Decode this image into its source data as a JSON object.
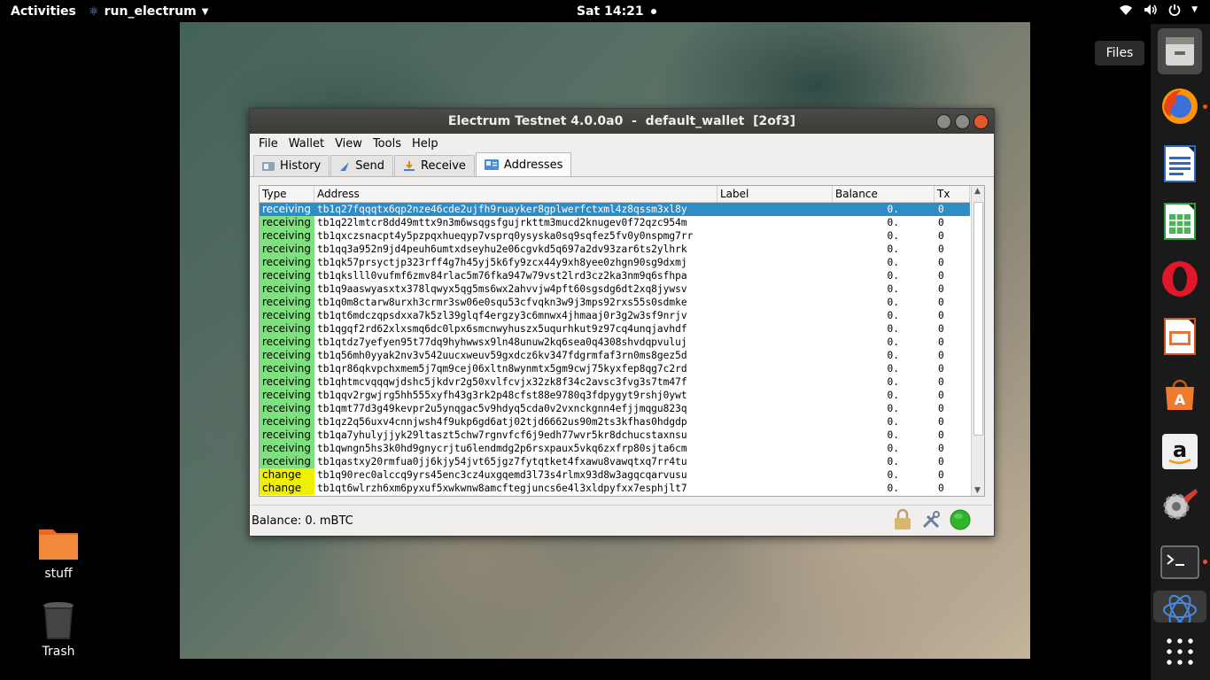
{
  "topbar": {
    "activities": "Activities",
    "app_name": "run_electrum",
    "clock": "Sat 14:21"
  },
  "dock": {
    "tooltip": "Files",
    "items": [
      "files-icon",
      "firefox-icon",
      "writer-icon",
      "calc-icon",
      "opera-icon",
      "impress-icon",
      "software-icon",
      "amazon-icon",
      "settings-icon",
      "terminal-icon",
      "electrum-icon",
      "show-apps-icon"
    ]
  },
  "desktop": {
    "stuff_label": "stuff",
    "trash_label": "Trash"
  },
  "window": {
    "title": "Electrum Testnet 4.0.0a0  -  default_wallet  [2of3]",
    "menus": [
      "File",
      "Wallet",
      "View",
      "Tools",
      "Help"
    ],
    "tabs": [
      "History",
      "Send",
      "Receive",
      "Addresses"
    ],
    "active_tab": "Addresses",
    "columns": [
      "Type",
      "Address",
      "Label",
      "Balance",
      "Tx"
    ],
    "rows": [
      {
        "type": "receiving",
        "address": "tb1q27fqqqtx6qp2nze46cde2ujfh9ruayker8gplwerfctxml4z8qssm3xl8y",
        "balance": "0.",
        "tx": "0"
      },
      {
        "type": "receiving",
        "address": "tb1q22lmtcr8dd49mttx9n3m6wsqgsfgujrkttm3mucd2knugev0f72qzc954m",
        "balance": "0.",
        "tx": "0"
      },
      {
        "type": "receiving",
        "address": "tb1qxczsnacpt4y5pzpqxhueqyp7vsprq0ysyska0sq9sqfez5fv0y0nspmg7rr",
        "balance": "0.",
        "tx": "0"
      },
      {
        "type": "receiving",
        "address": "tb1qq3a952n9jd4peuh6umtxdseyhu2e06cgvkd5q697a2dv93zar6ts2ylhrk",
        "balance": "0.",
        "tx": "0"
      },
      {
        "type": "receiving",
        "address": "tb1qk57prsyctjp323rff4g7h45yj5k6fy9zcx44y9xh8yee0zhgn90sg9dxmj",
        "balance": "0.",
        "tx": "0"
      },
      {
        "type": "receiving",
        "address": "tb1qkslll0vufmf6zmv84rlac5m76fka947w79vst2lrd3cz2ka3nm9q6sfhpa",
        "balance": "0.",
        "tx": "0"
      },
      {
        "type": "receiving",
        "address": "tb1q9aaswyasxtx378lqwyx5qg5ms6wx2ahvvjw4pft60sgsdg6dt2xq8jywsv",
        "balance": "0.",
        "tx": "0"
      },
      {
        "type": "receiving",
        "address": "tb1q0m8ctarw8urxh3crmr3sw06e0squ53cfvqkn3w9j3mps92rxs55s0sdmke",
        "balance": "0.",
        "tx": "0"
      },
      {
        "type": "receiving",
        "address": "tb1qt6mdczqpsdxxa7k5zl39glqf4ergzy3c6mnwx4jhmaaj0r3g2w3sf9nrjv",
        "balance": "0.",
        "tx": "0"
      },
      {
        "type": "receiving",
        "address": "tb1qgqf2rd62xlxsmq6dc0lpx6smcnwyhuszx5uqurhkut9z97cq4unqjavhdf",
        "balance": "0.",
        "tx": "0"
      },
      {
        "type": "receiving",
        "address": "tb1qtdz7yefyen95t77dq9hyhwwsx9ln48unuw2kq6sea0q4308shvdqpvuluj",
        "balance": "0.",
        "tx": "0"
      },
      {
        "type": "receiving",
        "address": "tb1q56mh0yyak2nv3v542uucxweuv59gxdcz6kv347fdgrmfaf3rn0ms8gez5d",
        "balance": "0.",
        "tx": "0"
      },
      {
        "type": "receiving",
        "address": "tb1qr86qkvpchxmem5j7qm9cej06xltn8wynmtx5gm9cwj75kyxfep8qg7c2rd",
        "balance": "0.",
        "tx": "0"
      },
      {
        "type": "receiving",
        "address": "tb1qhtmcvqqqwjdshc5jkdvr2g50xvlfcvjx32zk8f34c2avsc3fvg3s7tm47f",
        "balance": "0.",
        "tx": "0"
      },
      {
        "type": "receiving",
        "address": "tb1qqv2rgwjrg5hh555xyfh43g3rk2p48cfst88e9780q3fdpygyt9rshj0ywt",
        "balance": "0.",
        "tx": "0"
      },
      {
        "type": "receiving",
        "address": "tb1qmt77d3g49kevpr2u5ynqgac5v9hdyq5cda0v2vxnckgnn4efjjmqgu823q",
        "balance": "0.",
        "tx": "0"
      },
      {
        "type": "receiving",
        "address": "tb1qz2q56uxv4cnnjwsh4f9ukp6gd6atj02tjd6662us90m2ts3kfhas0hdgdp",
        "balance": "0.",
        "tx": "0"
      },
      {
        "type": "receiving",
        "address": "tb1qa7yhulyjjyk29ltaszt5chw7rgnvfcf6j9edh77wvr5kr8dchucstaxnsu",
        "balance": "0.",
        "tx": "0"
      },
      {
        "type": "receiving",
        "address": "tb1qwngn5hs3k0hd9gnycrjtu6lendmdg2p6rsxpaux5vkq6zxfrp80sjta6cm",
        "balance": "0.",
        "tx": "0"
      },
      {
        "type": "receiving",
        "address": "tb1qastxy20rmfua0jj6kjy54jvt65jgz7fytqtket4fxawu8vawqtxq7rr4tu",
        "balance": "0.",
        "tx": "0"
      },
      {
        "type": "change",
        "address": "tb1q90rec0alccq9yrs45enc3cz4uxgqemd3l73s4rlmx93d8w3agqcqarvusu",
        "balance": "0.",
        "tx": "0"
      },
      {
        "type": "change",
        "address": "tb1qt6wlrzh6xm6pyxuf5xwkwnw8amcftegjuncs6e4l3xldpyfxx7esphjlt7",
        "balance": "0.",
        "tx": "0"
      }
    ],
    "status_balance": "Balance: 0. mBTC"
  }
}
